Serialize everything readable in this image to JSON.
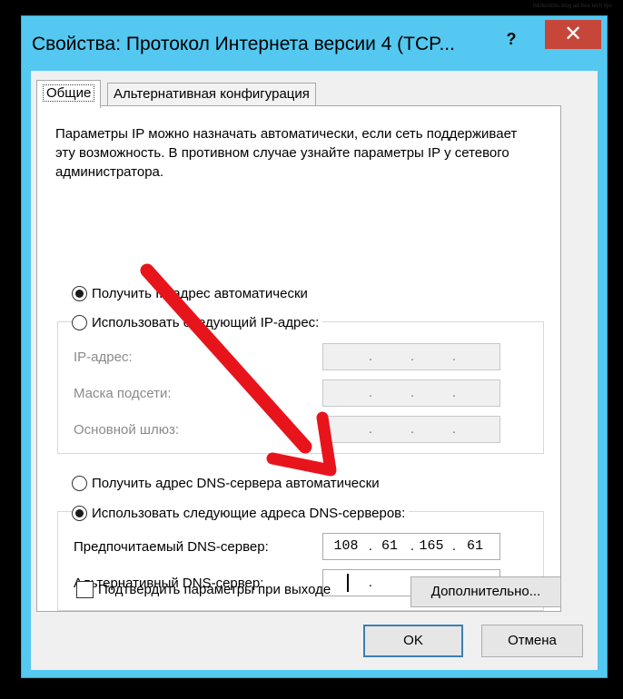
{
  "watermark": "fiddlesticks.blog ad-free tech tips",
  "window": {
    "title": "Свойства: Протокол Интернета версии 4 (TCP...",
    "help_symbol": "?",
    "close_symbol": "✕"
  },
  "tabs": [
    {
      "label": "Общие"
    },
    {
      "label": "Альтернативная конфигурация"
    }
  ],
  "description": "Параметры IP можно назначать автоматически, если сеть поддерживает эту возможность. В противном случае узнайте параметры IP у сетевого администратора.",
  "ip_section": {
    "auto_label": "Получить IP-адрес автоматически",
    "manual_label": "Использовать следующий IP-адрес:",
    "selected": "auto",
    "fields": [
      {
        "label": "IP-адрес:",
        "value": ". . ."
      },
      {
        "label": "Маска подсети:",
        "value": ". . ."
      },
      {
        "label": "Основной шлюз:",
        "value": ". . ."
      }
    ]
  },
  "dns_section": {
    "auto_label": "Получить адрес DNS-сервера автоматически",
    "manual_label": "Использовать следующие адреса DNS-серверов:",
    "selected": "manual",
    "preferred": {
      "label": "Предпочитаемый DNS-сервер:",
      "octets": [
        "108",
        "61",
        "165",
        "61"
      ]
    },
    "alternate": {
      "label": "Альтернативный DNS-сервер:",
      "octets": [
        "",
        "",
        "",
        ""
      ]
    }
  },
  "validate_on_exit_label": "Подтвердить параметры при выходе",
  "advanced_label": "Дополнительно...",
  "ok_label": "OK",
  "cancel_label": "Отмена",
  "colors": {
    "window_frame": "#54c8f0",
    "close_button": "#c7463a",
    "annotation_arrow": "#e8141c"
  }
}
